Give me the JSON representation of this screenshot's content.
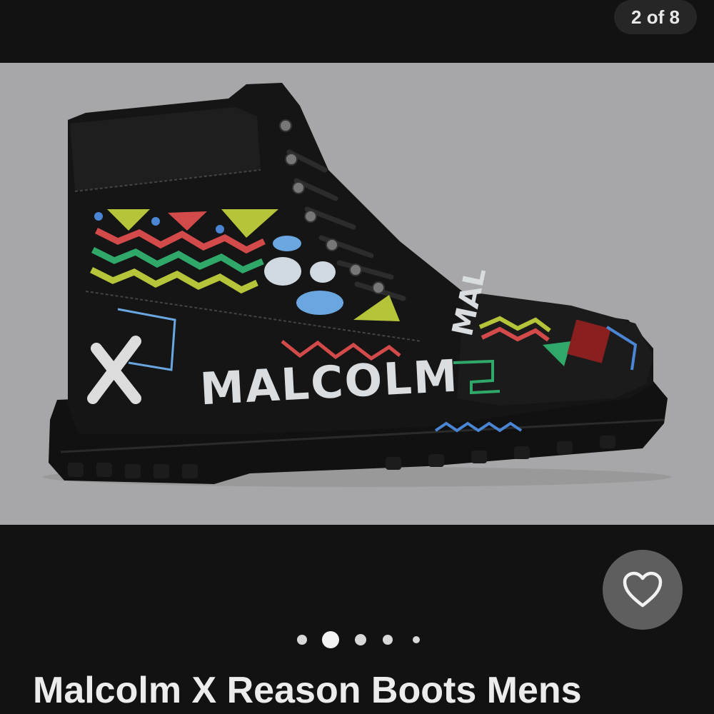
{
  "gallery": {
    "counter": "2 of 8",
    "total_dots": 5,
    "active_dot_index": 1
  },
  "favorite": {
    "icon": "heart-outline-icon"
  },
  "product": {
    "title": "Malcolm X Reason Boots Mens",
    "photo_alt": "Black lace-up boot with colorful MALCOLM graffiti print",
    "boot_print_text": "MALCOLM",
    "boot_tongue_text": "MAL"
  },
  "colors": {
    "background": "#121212",
    "photo_background": "#a7a7a9",
    "pill_background": "#262626",
    "favorite_background": "#5e5e5e"
  }
}
